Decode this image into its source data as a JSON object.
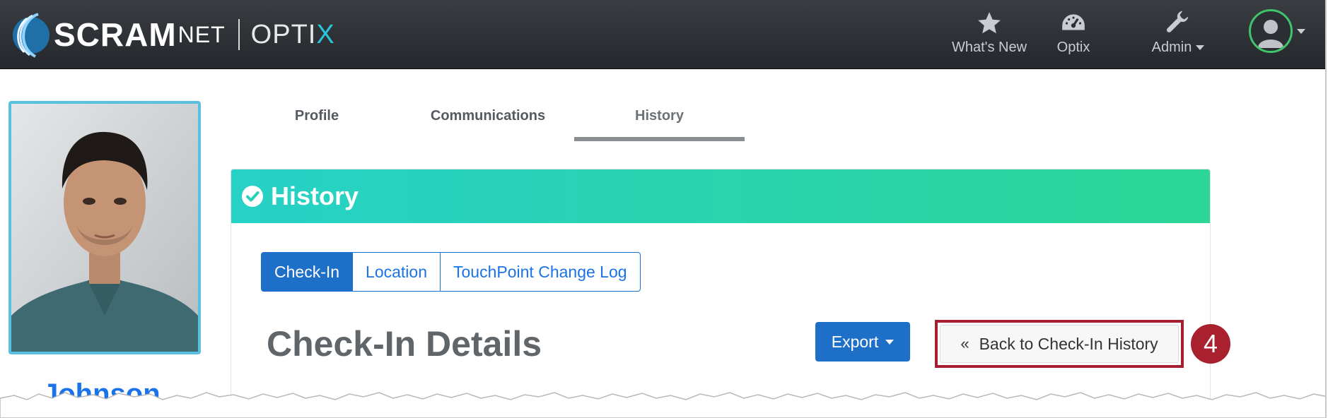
{
  "app": {
    "logo_scram": "SCRAM",
    "logo_net": "NET",
    "logo_optix": "OPTI",
    "logo_optix_x": "X"
  },
  "navbar": {
    "items": [
      {
        "label": "What's New",
        "icon": "star-icon"
      },
      {
        "label": "Optix",
        "icon": "dashboard-gauge-icon"
      },
      {
        "label": "Admin",
        "icon": "wrench-icon",
        "has_dropdown": true
      }
    ],
    "user_icon": "user-avatar-icon"
  },
  "profile": {
    "name": "Johnson,"
  },
  "tabs": [
    {
      "label": "Profile",
      "active": false
    },
    {
      "label": "Communications",
      "active": false
    },
    {
      "label": "History",
      "active": true
    }
  ],
  "panel": {
    "title": "History",
    "title_icon": "check-circle-icon",
    "subtabs": [
      {
        "label": "Check-In",
        "active": true
      },
      {
        "label": "Location",
        "active": false
      },
      {
        "label": "TouchPoint Change Log",
        "active": false
      }
    ],
    "section_title": "Check-In Details",
    "export_label": "Export",
    "back_label": "Back to Check-In History",
    "step_badge": "4"
  },
  "colors": {
    "navbar": "#2c2f34",
    "header_gradient_start": "#26d1c6",
    "header_gradient_end": "#2cd697",
    "primary": "#1e6fc8",
    "callout": "#a4202e",
    "avatar_ring": "#3fc56a"
  }
}
